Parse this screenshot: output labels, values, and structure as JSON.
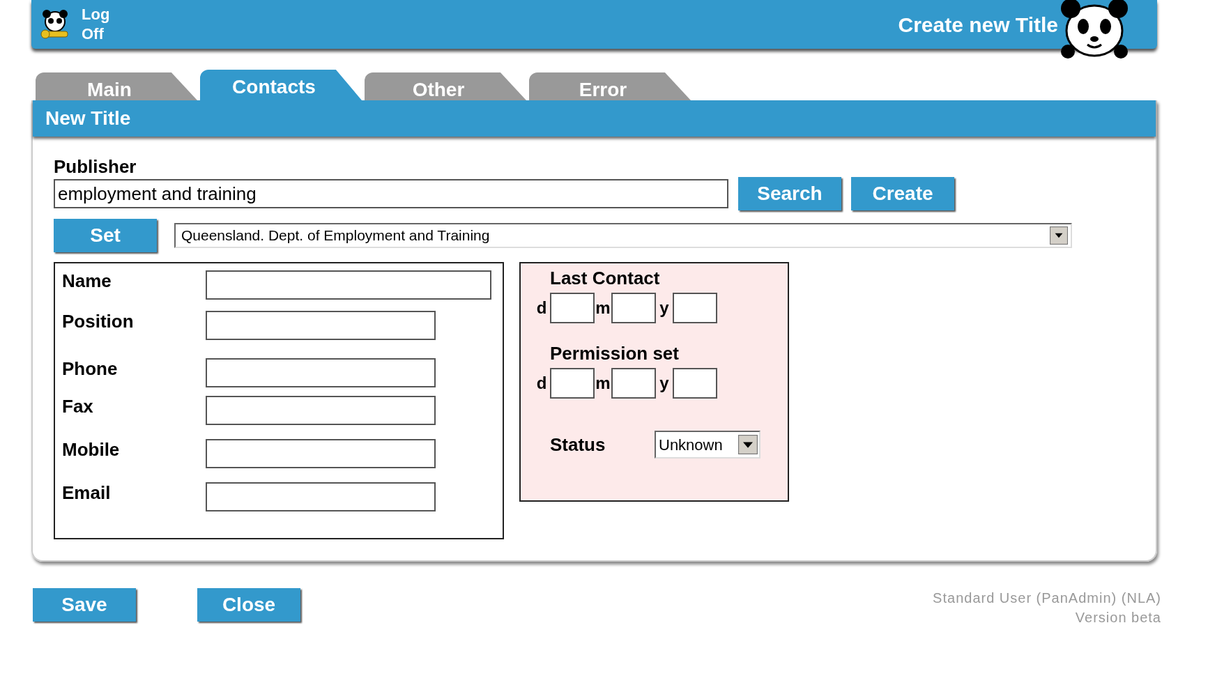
{
  "header": {
    "logoff": "Log Off",
    "title": "Create new Title"
  },
  "tabs": [
    {
      "label": "Main",
      "selected": false
    },
    {
      "label": "Contacts",
      "selected": true
    },
    {
      "label": "Other",
      "selected": false
    },
    {
      "label": "Error",
      "selected": false
    }
  ],
  "panel_title": "New Title",
  "publisher": {
    "label": "Publisher",
    "value": "employment and training",
    "buttons": [
      "Search",
      "Create"
    ],
    "set_button": "Set",
    "selection": "Queensland. Dept. of Employment and Training"
  },
  "contact_fields": [
    {
      "label": "Name"
    },
    {
      "label": "Position"
    },
    {
      "label": "Phone"
    },
    {
      "label": "Fax"
    },
    {
      "label": "Mobile"
    },
    {
      "label": "Email"
    }
  ],
  "dates": [
    {
      "label": "Last Contact",
      "parts": [
        "d",
        "m",
        "y"
      ]
    },
    {
      "label": "Permission set",
      "parts": [
        "d",
        "m",
        "y"
      ]
    }
  ],
  "status": {
    "label": "Status",
    "value": "Unknown"
  },
  "buttons": [
    "Save",
    "Close"
  ],
  "footer": [
    "Standard User (PanAdmin) (NLA)",
    "Version beta"
  ]
}
